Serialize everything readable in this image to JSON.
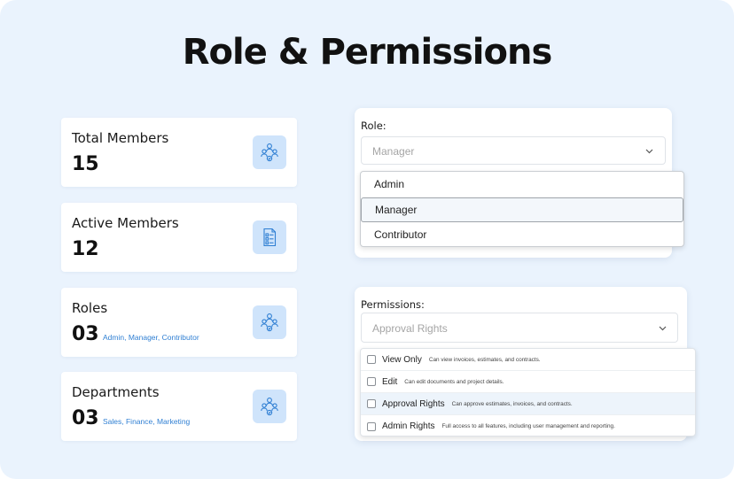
{
  "title": "Role & Permissions",
  "stats": [
    {
      "title": "Total Members",
      "value": "15",
      "note": "",
      "icon": "team-icon"
    },
    {
      "title": "Active Members",
      "value": "12",
      "note": "",
      "icon": "checklist-icon"
    },
    {
      "title": "Roles",
      "value": "03",
      "note": "Admin, Manager, Contributor",
      "icon": "team-icon"
    },
    {
      "title": "Departments",
      "value": "03",
      "note": "Sales, Finance, Marketing",
      "icon": "team-icon"
    }
  ],
  "role": {
    "label": "Role:",
    "selected": "Manager",
    "options": [
      "Admin",
      "Manager",
      "Contributor"
    ]
  },
  "permissions": {
    "label": "Permissions:",
    "selected": "Approval Rights",
    "options": [
      {
        "name": "View Only",
        "desc": "Can view invoices, estimates, and contracts."
      },
      {
        "name": "Edit",
        "desc": "Can edit documents and project details."
      },
      {
        "name": "Approval Rights",
        "desc": "Can approve estimates, invoices, and contracts."
      },
      {
        "name": "Admin Rights",
        "desc": "Full access to all features, including user management and reporting."
      }
    ]
  },
  "colors": {
    "background": "#eaf3fd",
    "accent": "#2f7fd3",
    "icon_tile": "#cfe4fb"
  }
}
